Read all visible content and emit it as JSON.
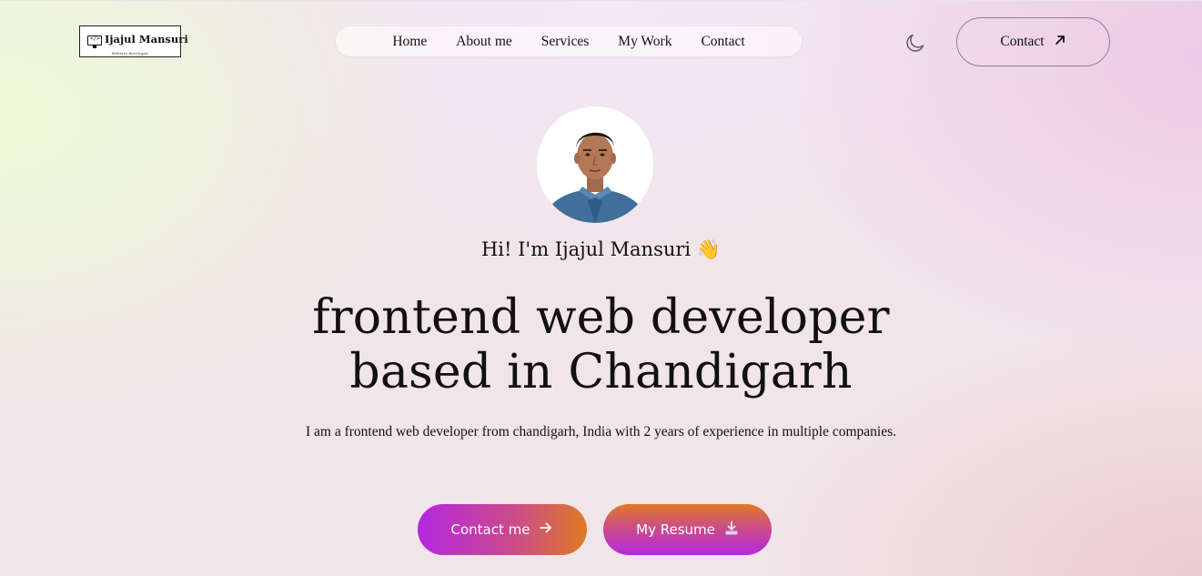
{
  "logo": {
    "name": "Ijajul Mansuri",
    "subtitle": "Website developer",
    "code_glyph": "</>"
  },
  "nav": {
    "items": [
      {
        "label": "Home"
      },
      {
        "label": "About me"
      },
      {
        "label": "Services"
      },
      {
        "label": "My Work"
      },
      {
        "label": "Contact"
      }
    ]
  },
  "header": {
    "theme_icon": "moon-icon",
    "contact_label": "Contact",
    "contact_icon": "arrow-up-right-icon"
  },
  "hero": {
    "avatar_icon": "profile-photo",
    "greeting": "Hi! I'm Ijajul Mansuri",
    "greeting_emoji": "👋",
    "headline_line1": "frontend web developer",
    "headline_line2": "based in Chandigarh",
    "description": "I am a frontend web developer from chandigarh, India with 2 years of experience in multiple companies.",
    "contact_button": "Contact me",
    "contact_button_icon": "arrow-right-icon",
    "resume_button": "My Resume",
    "resume_button_icon": "download-icon"
  },
  "colors": {
    "gradient_purple": "#b628e0",
    "gradient_orange": "#e07a25"
  }
}
